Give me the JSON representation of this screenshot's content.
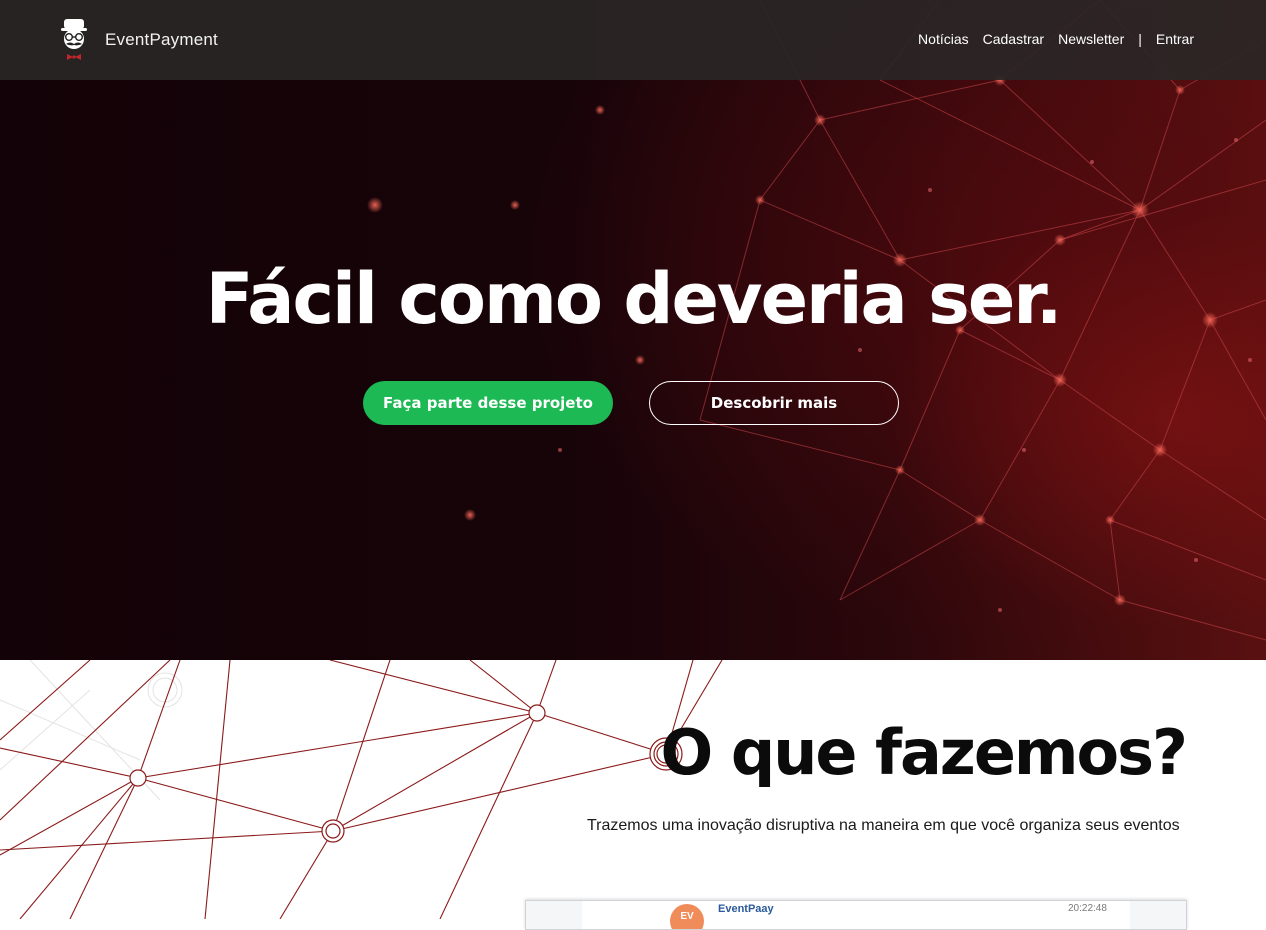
{
  "header": {
    "brand_name": "EventPayment",
    "logo_icon": "hipster-mustache-glasses-bowtie-logo",
    "nav": [
      {
        "label": "Notícias"
      },
      {
        "label": "Cadastrar"
      },
      {
        "label": "Newsletter"
      }
    ],
    "separator": "|",
    "login_label": "Entrar"
  },
  "hero": {
    "title": "Fácil como deveria ser.",
    "primary_cta": "Faça parte desse projeto",
    "secondary_cta": "Descobrir mais"
  },
  "about": {
    "title": "O que fazemos?",
    "description": "Trazemos uma inovação disruptiva na maneira em que você organiza seus eventos"
  },
  "preview": {
    "avatar_initials": "EV",
    "sender_name": "EventPaay",
    "timestamp": "20:22:48"
  },
  "colors": {
    "navbar_bg": "#2a2626",
    "accent_green": "#1db954",
    "network_red": "#8b1a1a",
    "hero_bg_dark": "#130207"
  }
}
